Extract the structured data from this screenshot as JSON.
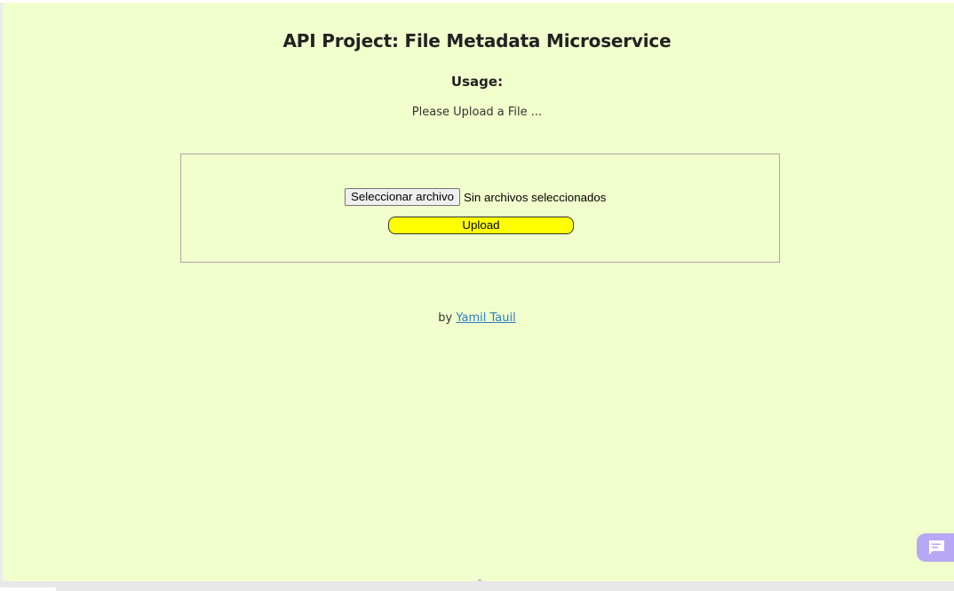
{
  "page": {
    "title": "API Project: File Metadata Microservice",
    "usage_heading": "Usage:",
    "instruction": "Please Upload a File ..."
  },
  "form": {
    "file_button_label": "Seleccionar archivo",
    "file_status": "Sin archivos seleccionados",
    "upload_label": "Upload"
  },
  "footer": {
    "prefix": "by",
    "author_link": "Yamil Tauil"
  },
  "icons": {
    "chat": "chat-bubble-icon",
    "scroll_caret": "chevron-up-icon"
  },
  "colors": {
    "page_background": "#f1ffcc",
    "upload_button": "#ffff00",
    "link": "#2c7fc0",
    "chat_widget": "#b7a8f5"
  }
}
